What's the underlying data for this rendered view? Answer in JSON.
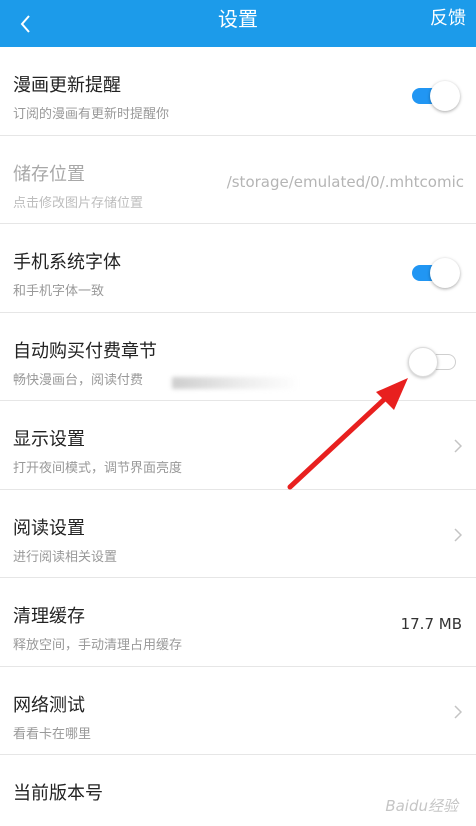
{
  "header": {
    "title": "设置",
    "action": "反馈",
    "background": "#1c9bea"
  },
  "rows": [
    {
      "title": "漫画更新提醒",
      "subtitle": "订阅的漫画有更新时提醒你",
      "control": "toggle",
      "toggle_on": true
    },
    {
      "title": "储存位置",
      "subtitle": "点击修改图片存储位置",
      "value": "/storage/emulated/0/.mhtcomic",
      "disabled": true
    },
    {
      "title": "手机系统字体",
      "subtitle": "和手机字体一致",
      "control": "toggle",
      "toggle_on": true
    },
    {
      "title": "自动购买付费章节",
      "subtitle": "畅快漫画台，阅读付费",
      "control": "toggle",
      "toggle_on": false
    },
    {
      "title": "显示设置",
      "subtitle": "打开夜间模式，调节界面亮度",
      "control": "chevron"
    },
    {
      "title": "阅读设置",
      "subtitle": "进行阅读相关设置",
      "control": "chevron"
    },
    {
      "title": "清理缓存",
      "subtitle": "释放空间，手动清理占用缓存",
      "value": "17.7 MB"
    },
    {
      "title": "网络测试",
      "subtitle": "看看卡在哪里",
      "control": "chevron"
    },
    {
      "title": "当前版本号"
    }
  ],
  "colors": {
    "toggle_on": "#2196f3",
    "annotation_arrow": "#e8201f"
  },
  "watermark": "Baidu经验"
}
